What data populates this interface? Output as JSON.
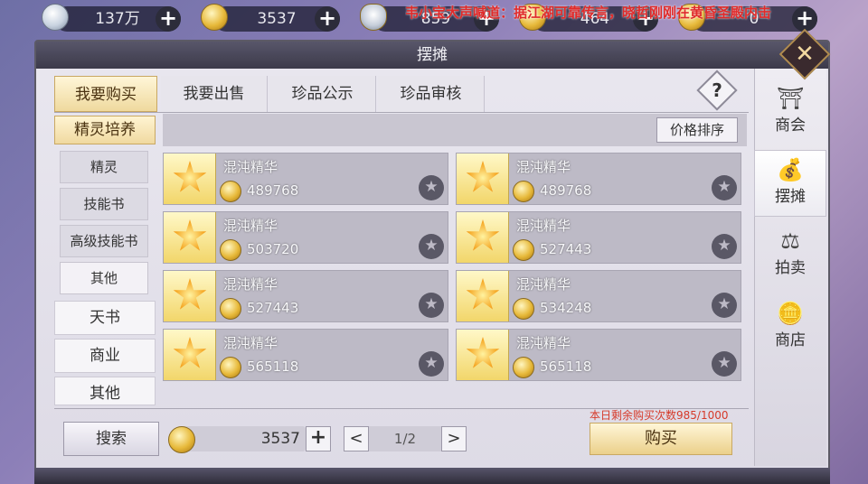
{
  "topbar": {
    "currencies": [
      {
        "icon": "silver-coin-icon",
        "value": "137万"
      },
      {
        "icon": "gold-coin-icon",
        "value": "3537"
      },
      {
        "icon": "silver-ingot-icon",
        "value": "859"
      },
      {
        "icon": "gold-ingot-icon",
        "value": "464"
      },
      {
        "icon": "gold-ingot-icon",
        "value": "0"
      }
    ],
    "marquee": "韦小宝大声喊道：据江湖可靠传言，晓哲刚刚在黄昏圣殿内击"
  },
  "window": {
    "title": "摆摊",
    "close_label": "✕"
  },
  "tabs": [
    {
      "label": "我要购买",
      "active": true
    },
    {
      "label": "我要出售",
      "active": false
    },
    {
      "label": "珍品公示",
      "active": false
    },
    {
      "label": "珍品审核",
      "active": false
    }
  ],
  "help_label": "?",
  "category_header": "精灵培养",
  "categories": [
    {
      "label": "精灵"
    },
    {
      "label": "技能书"
    },
    {
      "label": "高级技能书"
    },
    {
      "label": "其他"
    }
  ],
  "categories2": [
    {
      "label": "天书"
    },
    {
      "label": "商业"
    },
    {
      "label": "其他"
    }
  ],
  "sort_label": "价格排序",
  "items": [
    {
      "name": "混沌精华",
      "price": "489768"
    },
    {
      "name": "混沌精华",
      "price": "489768"
    },
    {
      "name": "混沌精华",
      "price": "503720"
    },
    {
      "name": "混沌精华",
      "price": "527443"
    },
    {
      "name": "混沌精华",
      "price": "527443"
    },
    {
      "name": "混沌精华",
      "price": "534248"
    },
    {
      "name": "混沌精华",
      "price": "565118"
    },
    {
      "name": "混沌精华",
      "price": "565118"
    }
  ],
  "footer": {
    "search_label": "搜索",
    "money": "3537",
    "money_plus": "+",
    "page": "1/2",
    "prev": "<",
    "next": ">",
    "remaining": "本日剩余购买次数985/1000",
    "buy_label": "购买"
  },
  "sidenav": [
    {
      "icon": "merchant-guild-icon",
      "label": "商会"
    },
    {
      "icon": "stall-bag-icon",
      "label": "摆摊",
      "active": true
    },
    {
      "icon": "auction-icon",
      "label": "拍卖"
    },
    {
      "icon": "shop-ingot-icon",
      "label": "商店"
    }
  ]
}
